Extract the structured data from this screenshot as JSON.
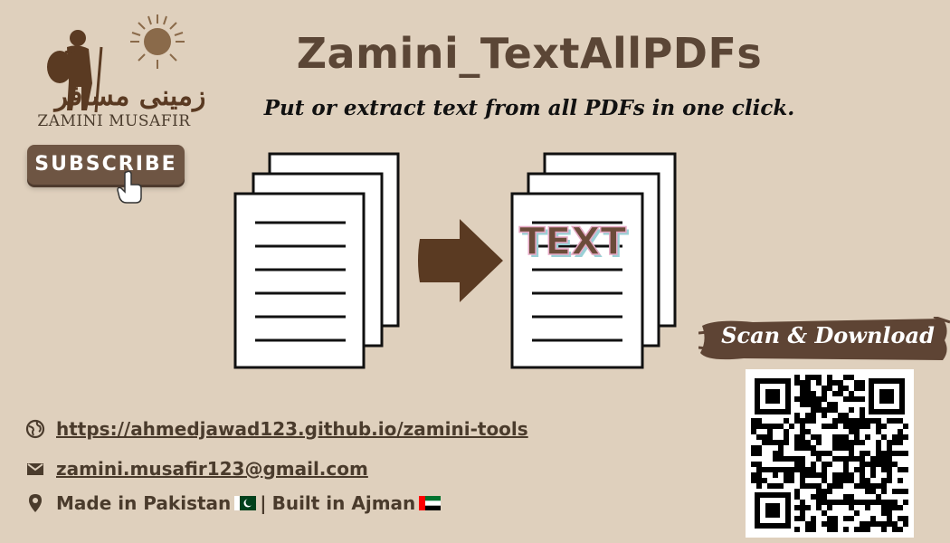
{
  "brand": {
    "name": "ZAMINI MUSAFIR",
    "urdu": "زمینی مسافر"
  },
  "subscribe_label": "SUBSCRIBE",
  "title": "Zamini_TextAllPDFs",
  "subtitle": "Put or extract text from all PDFs in one click.",
  "diagram": {
    "overlay_text": "TEXT"
  },
  "contact": {
    "website": "https://ahmedjawad123.github.io/zamini-tools",
    "email": "zamini.musafir123@gmail.com",
    "made_in": "Made in Pakistan",
    "separator": "|",
    "built_in": "Built in Ajman"
  },
  "scan_label": "Scan & Download",
  "colors": {
    "background": "#dfd0bd",
    "brown": "#5b4636",
    "dark_brown": "#4a3b2c",
    "arrow": "#5a3a22"
  }
}
